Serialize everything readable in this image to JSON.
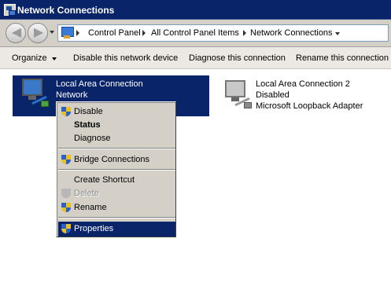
{
  "window": {
    "title": "Network Connections",
    "icon": "network-connections-icon"
  },
  "address_bar": {
    "crumbs": [
      "Control Panel",
      "All Control Panel Items",
      "Network Connections"
    ]
  },
  "command_bar": {
    "organize": "Organize",
    "disable_device": "Disable this network device",
    "diagnose": "Diagnose this connection",
    "rename": "Rename this connection"
  },
  "connections": [
    {
      "name": "Local Area Connection",
      "status": "Network",
      "icon": "network-adapter-icon",
      "selected": true
    },
    {
      "name": "Local Area Connection 2",
      "status": "Disabled",
      "device": "Microsoft Loopback Adapter",
      "icon": "network-adapter-disabled-icon",
      "selected": false
    }
  ],
  "context_menu": {
    "items": [
      {
        "label": "Disable",
        "shield": true
      },
      {
        "label": "Status",
        "bold": true
      },
      {
        "label": "Diagnose"
      },
      {
        "label": "Bridge Connections",
        "shield": true
      },
      {
        "label": "Create Shortcut"
      },
      {
        "label": "Delete",
        "shield": true,
        "disabled": true
      },
      {
        "label": "Rename",
        "shield": true
      },
      {
        "label": "Properties",
        "shield": true,
        "highlighted": true
      }
    ]
  },
  "colors": {
    "title_bg": "#0a246a",
    "selection": "#0a246a",
    "menu_bg": "#d4d0c8"
  }
}
